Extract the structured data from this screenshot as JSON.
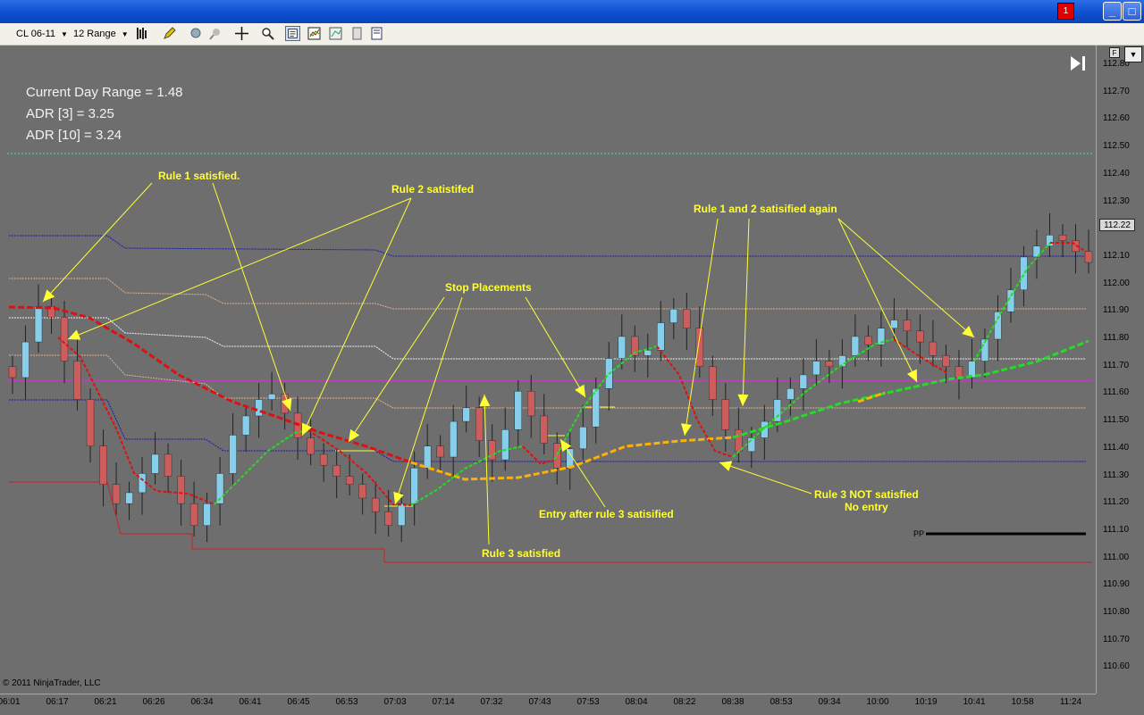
{
  "window": {
    "alert_badge": "1",
    "minimize": "_",
    "maximize": "□",
    "close": "×"
  },
  "toolbar": {
    "instrument": "CL 06-11",
    "period": "12 Range"
  },
  "overlay": {
    "current_day_range": "Current Day Range = 1.48",
    "adr3": "ADR [3] = 3.25",
    "adr10": "ADR [10] = 3.24"
  },
  "annotations": {
    "rule1": "Rule 1 satisfied.",
    "rule2": "Rule 2 satistifed",
    "stop": "Stop Placements",
    "rule12again": "Rule 1 and 2 satisified again",
    "rule3not_line1": "Rule 3 NOT satisfied",
    "rule3not_line2": "No entry",
    "entry": "Entry after rule 3 satisified",
    "rule3": "Rule 3 satisfied"
  },
  "pivot_label": "PP",
  "last_price": "112.22",
  "copyright": "© 2011 NinjaTrader, LLC",
  "y_axis": [
    "112.80",
    "112.70",
    "112.60",
    "112.50",
    "112.40",
    "112.30",
    "112.20",
    "112.10",
    "112.00",
    "111.90",
    "111.80",
    "111.70",
    "111.60",
    "111.50",
    "111.40",
    "111.30",
    "111.20",
    "111.10",
    "111.00",
    "110.90",
    "110.80",
    "110.70",
    "110.60"
  ],
  "x_axis": [
    "06:01",
    "06:17",
    "06:21",
    "06:26",
    "06:34",
    "06:41",
    "06:45",
    "06:53",
    "07:03",
    "07:14",
    "07:32",
    "07:43",
    "07:53",
    "08:04",
    "08:22",
    "08:38",
    "08:53",
    "09:34",
    "10:00",
    "10:19",
    "10:41",
    "10:58",
    "11:24"
  ],
  "colors": {
    "up_candle": "#87ceeb",
    "down_candle": "#cd5c5c",
    "ma_down": "#dd1111",
    "ma_up": "#22dd22",
    "ma_flat": "#ffb000",
    "annotation": "#ffff33"
  },
  "chart_data": {
    "type": "candlestick",
    "y_range": [
      110.55,
      112.85
    ],
    "closes": [
      111.66,
      111.79,
      111.92,
      111.88,
      111.72,
      111.58,
      111.41,
      111.27,
      111.2,
      111.24,
      111.31,
      111.38,
      111.3,
      111.2,
      111.12,
      111.2,
      111.31,
      111.45,
      111.52,
      111.58,
      111.6,
      111.53,
      111.44,
      111.38,
      111.34,
      111.3,
      111.27,
      111.22,
      111.17,
      111.12,
      111.2,
      111.33,
      111.41,
      111.37,
      111.5,
      111.55,
      111.43,
      111.36,
      111.47,
      111.61,
      111.52,
      111.42,
      111.33,
      111.4,
      111.48,
      111.62,
      111.73,
      111.81,
      111.74,
      111.76,
      111.86,
      111.91,
      111.84,
      111.7,
      111.58,
      111.47,
      111.39,
      111.44,
      111.5,
      111.58,
      111.62,
      111.67,
      111.72,
      111.7,
      111.74,
      111.81,
      111.78,
      111.84,
      111.87,
      111.83,
      111.79,
      111.74,
      111.7,
      111.66,
      111.72,
      111.8,
      111.9,
      111.98,
      112.1,
      112.14,
      112.18,
      112.16,
      112.12,
      112.08
    ]
  }
}
